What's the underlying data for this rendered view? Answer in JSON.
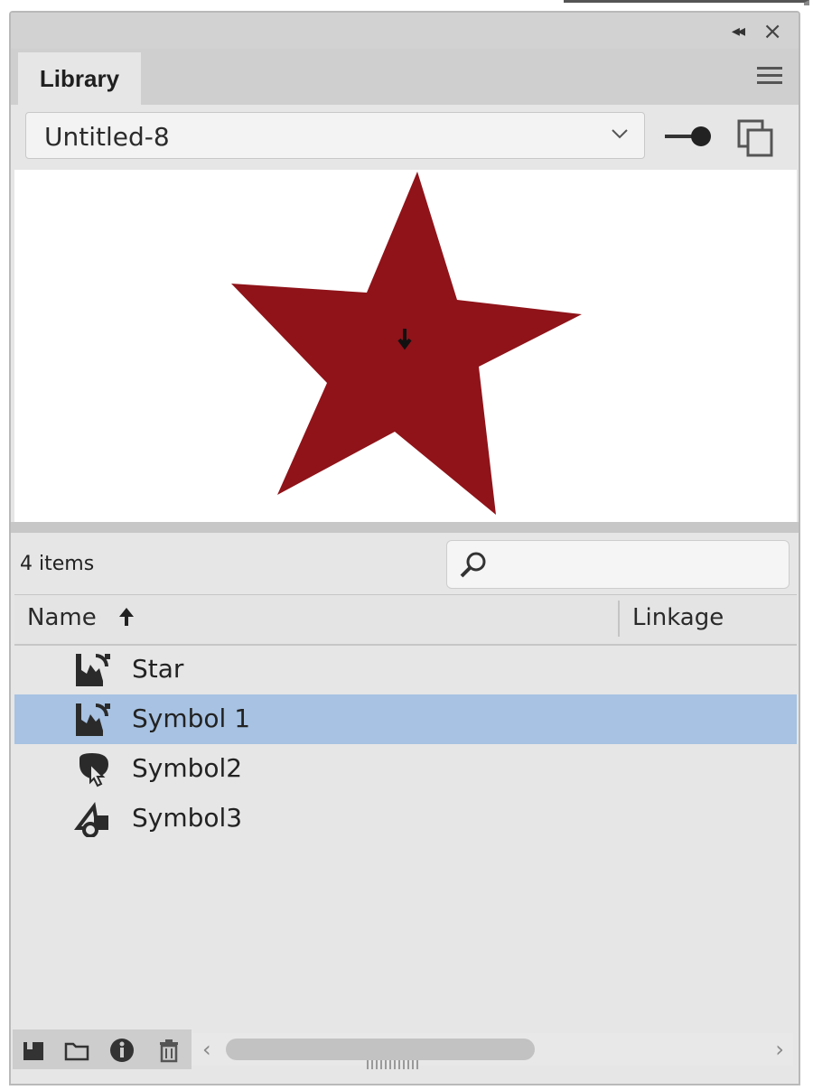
{
  "panel": {
    "tab_label": "Library",
    "document": "Untitled-8",
    "item_count": "4 items",
    "search_placeholder": "",
    "columns": {
      "name": "Name",
      "linkage": "Linkage"
    }
  },
  "items": [
    {
      "label": "Star",
      "icon": "movie-clip-icon",
      "selected": false
    },
    {
      "label": "Symbol 1",
      "icon": "movie-clip-icon",
      "selected": true
    },
    {
      "label": "Symbol2",
      "icon": "button-symbol-icon",
      "selected": false
    },
    {
      "label": "Symbol3",
      "icon": "graphic-symbol-icon",
      "selected": false
    }
  ],
  "preview": {
    "shape": "star",
    "fill": "#8f1319"
  },
  "colors": {
    "selection": "#a7c2e2",
    "panel_bg": "#e6e6e6"
  }
}
